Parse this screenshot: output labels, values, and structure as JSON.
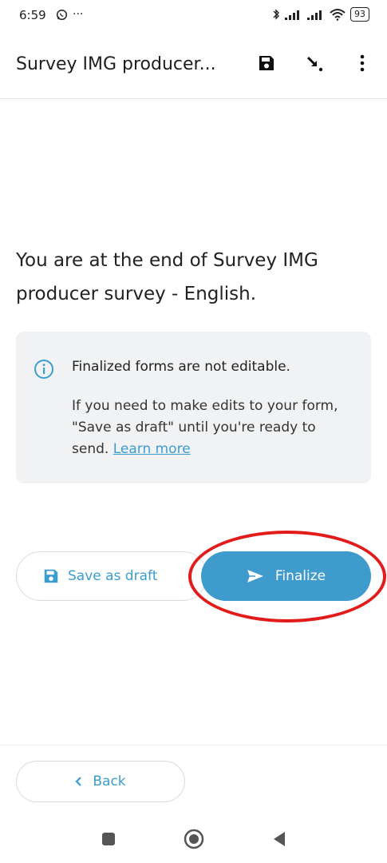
{
  "status_bar": {
    "time": "6:59",
    "left_icons": [
      "whatsapp-icon",
      "more-dots"
    ],
    "more_text": "···",
    "battery": "93"
  },
  "app_bar": {
    "title": "Survey IMG producer...",
    "actions": [
      "save-icon",
      "jump-icon",
      "overflow-menu-icon"
    ]
  },
  "main": {
    "end_message": "You are at the end of Survey IMG producer survey - English.",
    "info": {
      "title": "Finalized forms are not editable.",
      "body": "If you need to make edits to your form, \"Save as draft\" until you're ready to send.",
      "link": "Learn more"
    },
    "save_draft_label": "Save as draft",
    "finalize_label": "Finalize",
    "back_label": "Back"
  },
  "colors": {
    "accent": "#3f9bcc",
    "highlight": "#e21b1b",
    "card_bg": "#f1f2f3"
  }
}
